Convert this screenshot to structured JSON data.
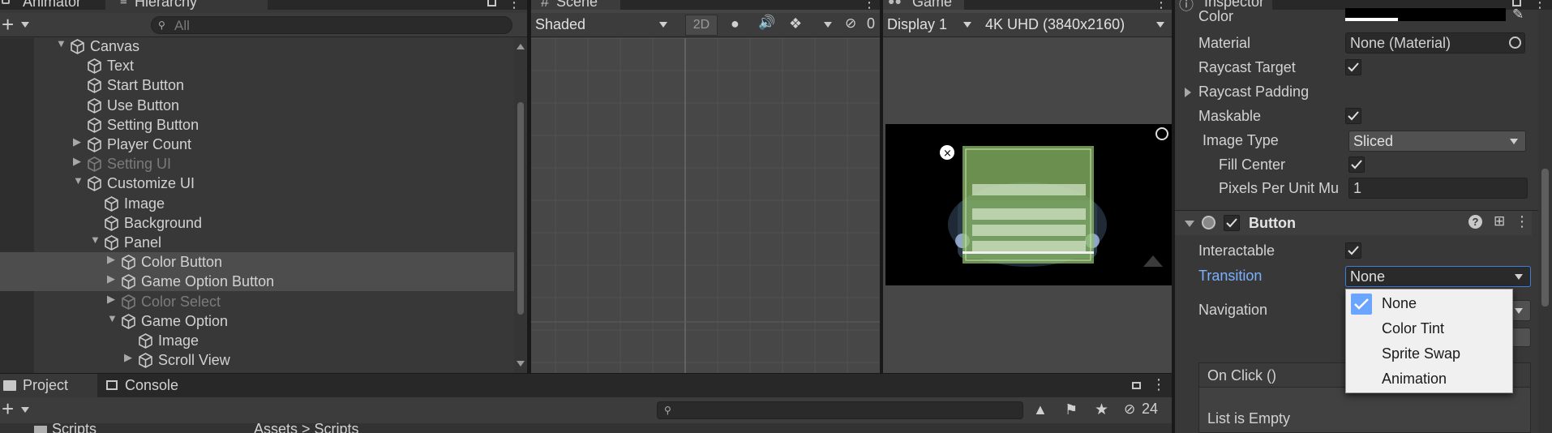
{
  "hierarchy": {
    "tabs": {
      "animator": "Animator",
      "hierarchy": "Hierarchy"
    },
    "search_placeholder": "All",
    "rows": [
      {
        "label": "Canvas"
      },
      {
        "label": "Text"
      },
      {
        "label": "Start Button"
      },
      {
        "label": "Use Button"
      },
      {
        "label": "Setting Button"
      },
      {
        "label": "Player Count"
      },
      {
        "label": "Setting UI"
      },
      {
        "label": "Customize UI"
      },
      {
        "label": "Image"
      },
      {
        "label": "Background"
      },
      {
        "label": "Panel"
      },
      {
        "label": "Color Button"
      },
      {
        "label": "Game Option Button"
      },
      {
        "label": "Color Select"
      },
      {
        "label": "Game Option"
      },
      {
        "label": "Image"
      },
      {
        "label": "Scroll View"
      }
    ]
  },
  "scene": {
    "tab": "Scene",
    "draw_mode": "Shaded",
    "toggle_2d": "2D",
    "hidden_count": "0"
  },
  "game": {
    "tab": "Game",
    "display": "Display 1",
    "resolution": "4K UHD (3840x2160)"
  },
  "inspector": {
    "tab": "Inspector",
    "image": {
      "color_label": "Color",
      "material_label": "Material",
      "material_value": "None (Material)",
      "raycast_target_label": "Raycast Target",
      "raycast_padding_label": "Raycast Padding",
      "maskable_label": "Maskable",
      "image_type_label": "Image Type",
      "image_type_value": "Sliced",
      "fill_center_label": "Fill Center",
      "ppu_label": "Pixels Per Unit Mu",
      "ppu_value": "1"
    },
    "button": {
      "title": "Button",
      "interactable_label": "Interactable",
      "transition_label": "Transition",
      "transition_value": "None",
      "navigation_label": "Navigation",
      "on_click_label": "On Click ()",
      "list_empty": "List is Empty"
    },
    "transition_options": [
      "None",
      "Color Tint",
      "Sprite Swap",
      "Animation"
    ],
    "selected_option": "None",
    "accent_color": "#7bb0ff"
  },
  "project": {
    "tabs": {
      "project": "Project",
      "console": "Console"
    },
    "hidden_count": "24",
    "folder": "Scripts",
    "breadcrumb": "Assets > Scripts"
  }
}
